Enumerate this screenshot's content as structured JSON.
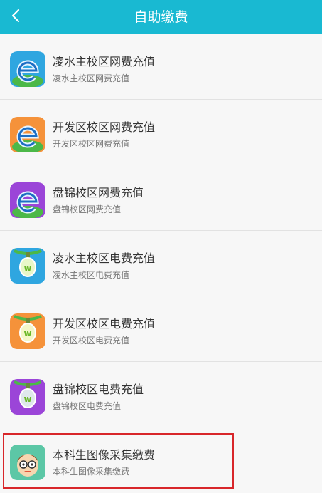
{
  "header": {
    "title": "自助缴费",
    "back_icon": "chevron-left-icon"
  },
  "items": [
    {
      "title": "凌水主校区网费充值",
      "subtitle": "凌水主校区网费充值",
      "icon": "internet-e-icon",
      "color": "#2fa6e0"
    },
    {
      "title": "开发区校区网费充值",
      "subtitle": "开发区校区网费充值",
      "icon": "internet-e-icon",
      "color": "#f5923a"
    },
    {
      "title": "盘锦校区网费充值",
      "subtitle": "盘锦校区网费充值",
      "icon": "internet-e-icon",
      "color": "#9b45d8"
    },
    {
      "title": "凌水主校区电费充值",
      "subtitle": "凌水主校区电费充值",
      "icon": "lightbulb-icon",
      "color": "#2fa6e0"
    },
    {
      "title": "开发区校区电费充值",
      "subtitle": "开发区校区电费充值",
      "icon": "lightbulb-icon",
      "color": "#f5923a"
    },
    {
      "title": "盘锦校区电费充值",
      "subtitle": "盘锦校区电费充值",
      "icon": "lightbulb-icon",
      "color": "#9b45d8"
    },
    {
      "title": "本科生图像采集缴费",
      "subtitle": "本科生图像采集缴费",
      "icon": "student-face-icon",
      "color": "#5cc7a6"
    }
  ],
  "colors": {
    "header_bg": "#19b9d2",
    "highlight": "#d8262a",
    "divider": "#e2e2e2"
  }
}
